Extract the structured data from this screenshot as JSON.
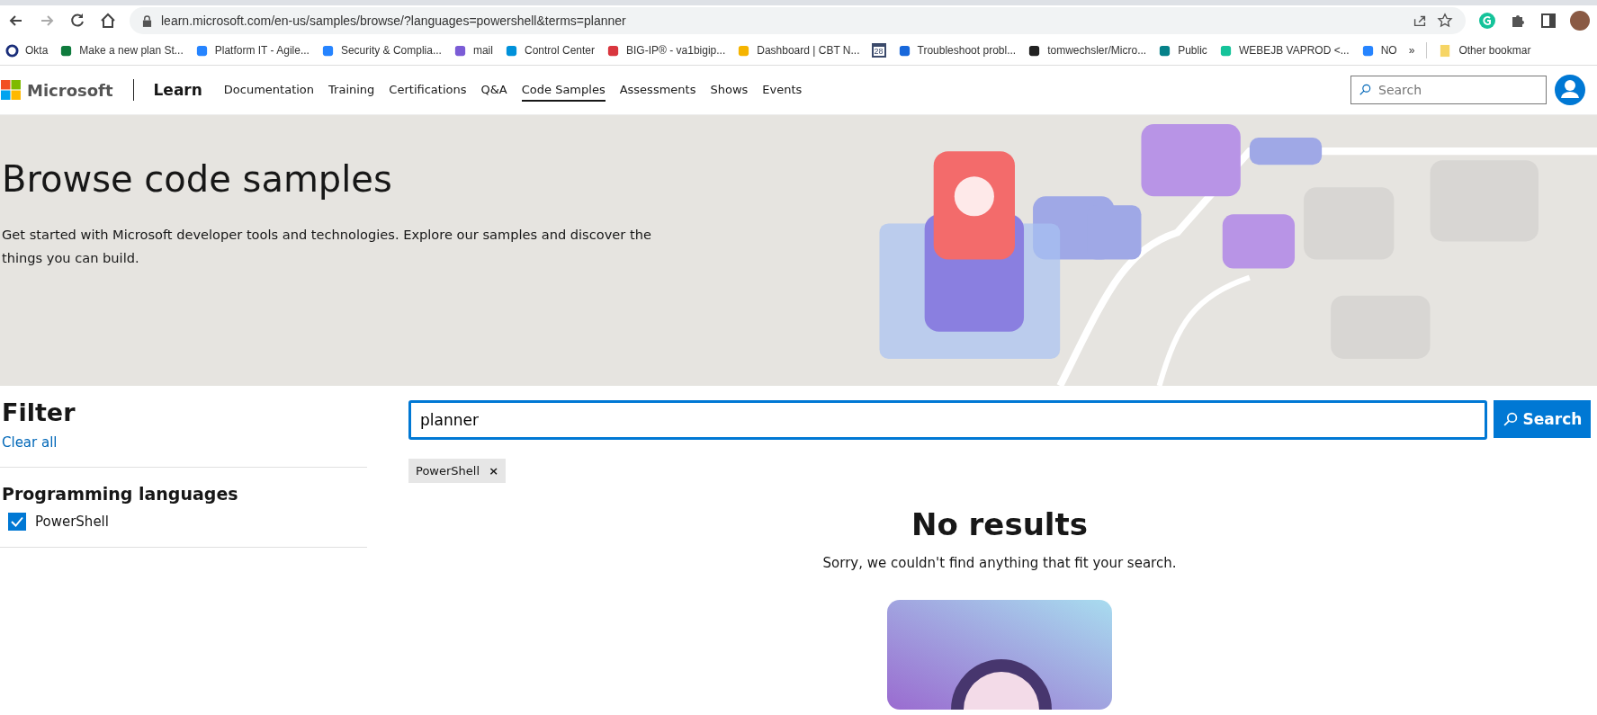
{
  "browser": {
    "url": "learn.microsoft.com/en-us/samples/browse/?languages=powershell&terms=planner",
    "bookmarks": [
      {
        "label": "Okta"
      },
      {
        "label": "Make a new plan St..."
      },
      {
        "label": "Platform IT - Agile..."
      },
      {
        "label": "Security & Complia..."
      },
      {
        "label": "mail"
      },
      {
        "label": "Control Center"
      },
      {
        "label": "BIG-IP® - va1bigip..."
      },
      {
        "label": "Dashboard | CBT N..."
      },
      {
        "badge": "28"
      },
      {
        "label": "Troubleshoot probl..."
      },
      {
        "label": "tomwechsler/Micro..."
      },
      {
        "label": "Public"
      },
      {
        "label": "WEBEJB VAPROD <..."
      },
      {
        "label": "NO"
      }
    ],
    "overflow": "»",
    "other": "Other bookmar"
  },
  "site": {
    "brand": "Microsoft",
    "product": "Learn",
    "nav": [
      {
        "label": "Documentation",
        "selected": false
      },
      {
        "label": "Training",
        "selected": false
      },
      {
        "label": "Certifications",
        "selected": false
      },
      {
        "label": "Q&A",
        "selected": false
      },
      {
        "label": "Code Samples",
        "selected": true
      },
      {
        "label": "Assessments",
        "selected": false
      },
      {
        "label": "Shows",
        "selected": false
      },
      {
        "label": "Events",
        "selected": false
      }
    ],
    "search_placeholder": "Search"
  },
  "hero": {
    "title": "Browse code samples",
    "text": "Get started with Microsoft developer tools and technologies. Explore our samples and discover the things you can build."
  },
  "filter": {
    "title": "Filter",
    "clear": "Clear all",
    "group": "Programming languages",
    "options": [
      {
        "label": "PowerShell",
        "checked": true
      }
    ]
  },
  "search": {
    "value": "planner",
    "button": "Search"
  },
  "chips": [
    {
      "label": "PowerShell",
      "remove": "×"
    }
  ],
  "empty": {
    "title": "No results",
    "text": "Sorry, we couldn't find anything that fit your search."
  }
}
